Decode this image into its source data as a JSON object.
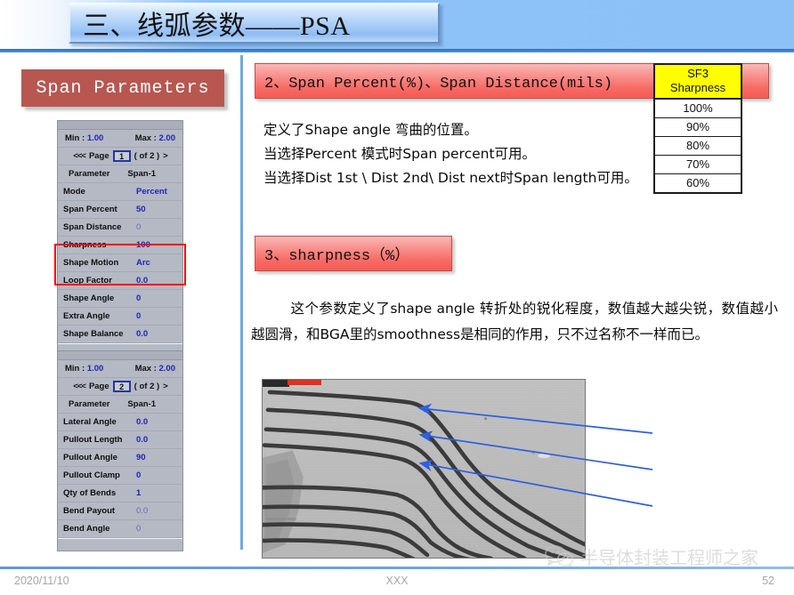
{
  "slide": {
    "title": "三、线弧参数——PSA"
  },
  "left": {
    "panel_title": "Span  Parameters",
    "page1": {
      "min_label": "Min :",
      "min_value": "1.00",
      "max_label": "Max :",
      "max_value": "2.00",
      "prev_arrow": "<<<",
      "page_label": "Page",
      "page_value": "1",
      "of_label": "( of 2 )",
      "next_arrow": ">",
      "col_param": "Parameter",
      "col_value": "Span-1",
      "rows": [
        {
          "label": "Mode",
          "value": "Percent",
          "dim": false
        },
        {
          "label": "Span Percent",
          "value": "50",
          "dim": false
        },
        {
          "label": "Span Distance",
          "value": "0",
          "dim": true
        },
        {
          "label": "Sharpness",
          "value": "100",
          "dim": false
        },
        {
          "label": "Shape Motion",
          "value": "Arc",
          "dim": false
        },
        {
          "label": "Loop Factor",
          "value": "0.0",
          "dim": false
        },
        {
          "label": "Shape Angle",
          "value": "0",
          "dim": false
        },
        {
          "label": "Extra Angle",
          "value": "0",
          "dim": false
        },
        {
          "label": "Shape Balance",
          "value": "0.0",
          "dim": false
        }
      ]
    },
    "page2": {
      "min_label": "Min :",
      "min_value": "1.00",
      "max_label": "Max :",
      "max_value": "2.00",
      "prev_arrow": "<<<",
      "page_label": "Page",
      "page_value": "2",
      "of_label": "( of 2 )",
      "next_arrow": ">",
      "col_param": "Parameter",
      "col_value": "Span-1",
      "rows": [
        {
          "label": "Lateral Angle",
          "value": "0.0",
          "dim": false
        },
        {
          "label": "Pullout Length",
          "value": "0.0",
          "dim": false
        },
        {
          "label": "Pullout Angle",
          "value": "90",
          "dim": false
        },
        {
          "label": "Pullout Clamp",
          "value": "0",
          "dim": false
        },
        {
          "label": "Qty of Bends",
          "value": "1",
          "dim": false
        },
        {
          "label": "Bend Payout",
          "value": "0.0",
          "dim": true
        },
        {
          "label": "Bend Angle",
          "value": "0",
          "dim": true
        }
      ]
    },
    "highlight_color": "#ff0000"
  },
  "right": {
    "section2_title": "2、Span Percent(%)、Span Distance(mils)",
    "section2_lines": [
      "定义了Shape angle 弯曲的位置。",
      "当选择Percent 模式时Span percent可用。",
      "当选择Dist 1st \\ Dist 2nd\\ Dist next时Span length可用。"
    ],
    "section3_title": "3、sharpness（%）",
    "section3_paragraph": "这个参数定义了shape angle 转折处的锐化程度，数值越大越尖锐，数值越小越圆滑，和BGA里的smoothness是相同的作用，只不过名称不一样而已。",
    "sf_table": {
      "head_line1": "SF3",
      "head_line2": "Sharpness",
      "rows": [
        "100%",
        "90%",
        "80%",
        "70%",
        "60%"
      ],
      "head_bg": "#ffff00"
    },
    "arrow_color": "#2f5fe0"
  },
  "footer": {
    "date": "2020/11/10",
    "center": "XXX",
    "page_number": "52",
    "watermark_text": "半导体封装工程师之家"
  }
}
